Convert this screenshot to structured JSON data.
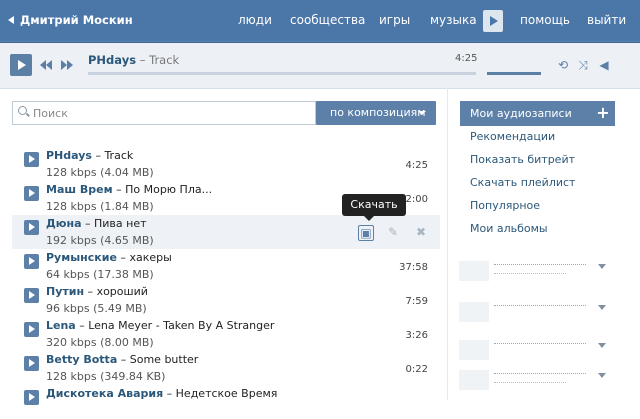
{
  "topbar": {
    "user": "Дмитрий Москин",
    "nav": [
      "люди",
      "сообщества",
      "игры",
      "музыка",
      "помощь",
      "выйти"
    ]
  },
  "player": {
    "artist": "PHdays",
    "separator": "–",
    "title": "Track",
    "time": "4:25"
  },
  "search": {
    "placeholder": "Поиск",
    "filter": "по композициям"
  },
  "tooltip": "Скачать",
  "tracks": [
    {
      "artist": "PHdays",
      "title": "Track",
      "bitrate": "128",
      "unit": "kbps",
      "size": "(4.04 MB)",
      "duration": "4:25"
    },
    {
      "artist": "Маш Врем",
      "title": "По Морю Пла...",
      "bitrate": "128",
      "unit": "kbps",
      "size": "(1.84 MB)",
      "duration": "2:00"
    },
    {
      "artist": "Дюна",
      "title": "Пива нет",
      "bitrate": "192",
      "unit": "kbps",
      "size": "(4.65 MB)",
      "duration": ""
    },
    {
      "artist": "Румынские",
      "title": "хакеры",
      "bitrate": "64",
      "unit": "kbps",
      "size": "(17.38 MB)",
      "duration": "37:58"
    },
    {
      "artist": "Путин",
      "title": "хороший",
      "bitrate": "96",
      "unit": "kbps",
      "size": "(5.49 MB)",
      "duration": "7:59"
    },
    {
      "artist": "Lena",
      "title": "Lena Meyer - Taken By A Stranger",
      "bitrate": "320",
      "unit": "kbps",
      "size": "(8.00 MB)",
      "duration": "3:26"
    },
    {
      "artist": "Betty Botta",
      "title": "Some butter",
      "bitrate": "128",
      "unit": "kbps",
      "size": "(349.84 KB)",
      "duration": "0:22"
    },
    {
      "artist": "Дискотека Авария",
      "title": "Недетское Время",
      "bitrate": "",
      "unit": "",
      "size": "",
      "duration": ""
    }
  ],
  "sidebar": {
    "header": "Мои аудиозаписи",
    "links": [
      "Рекомендации",
      "Показать битрейт",
      "Скачать плейлист",
      "Популярное",
      "Мои альбомы"
    ]
  },
  "colors": {
    "topbar": "#4a76a8",
    "accent": "#5c80a8",
    "link": "#2b587a"
  }
}
